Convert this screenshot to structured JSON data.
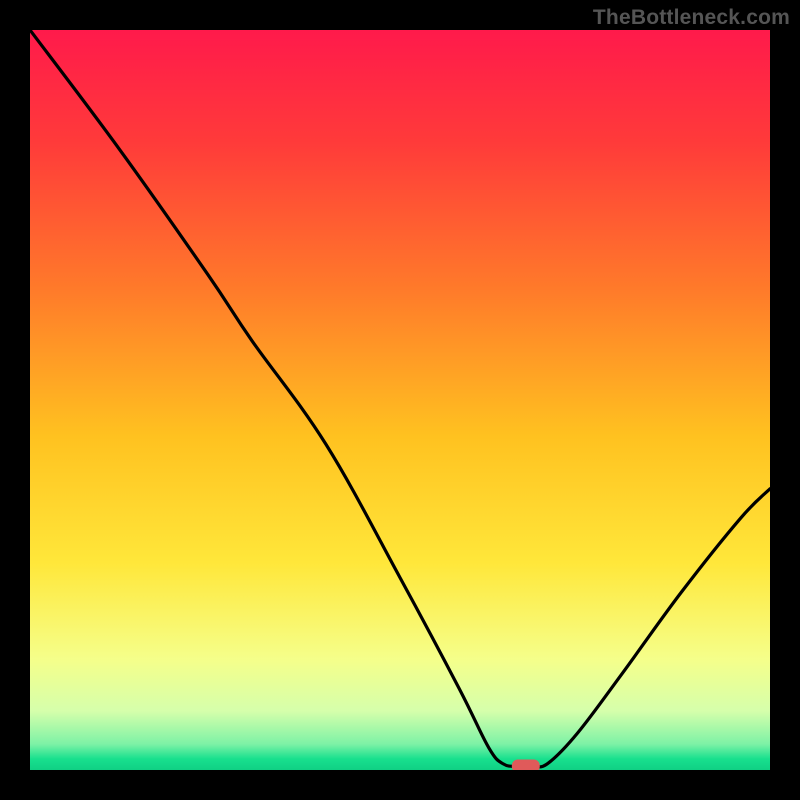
{
  "watermark": "TheBottleneck.com",
  "chart_data": {
    "type": "line",
    "title": "",
    "xlabel": "",
    "ylabel": "",
    "xlim": [
      0,
      100
    ],
    "ylim": [
      0,
      100
    ],
    "gradient_bands": [
      {
        "stop": 0.0,
        "color": "#ff1a4b"
      },
      {
        "stop": 0.15,
        "color": "#ff3a3a"
      },
      {
        "stop": 0.35,
        "color": "#ff7a2a"
      },
      {
        "stop": 0.55,
        "color": "#ffc220"
      },
      {
        "stop": 0.72,
        "color": "#ffe73a"
      },
      {
        "stop": 0.85,
        "color": "#f5ff8a"
      },
      {
        "stop": 0.92,
        "color": "#d6ffab"
      },
      {
        "stop": 0.965,
        "color": "#7df2a6"
      },
      {
        "stop": 0.985,
        "color": "#18e08e"
      },
      {
        "stop": 1.0,
        "color": "#10d084"
      }
    ],
    "series": [
      {
        "name": "curve",
        "points": [
          {
            "x": 0,
            "y": 100
          },
          {
            "x": 12,
            "y": 84
          },
          {
            "x": 24,
            "y": 67
          },
          {
            "x": 30,
            "y": 58
          },
          {
            "x": 40,
            "y": 44
          },
          {
            "x": 50,
            "y": 26
          },
          {
            "x": 58,
            "y": 11
          },
          {
            "x": 62,
            "y": 3
          },
          {
            "x": 64,
            "y": 0.8
          },
          {
            "x": 66,
            "y": 0.5
          },
          {
            "x": 68,
            "y": 0.5
          },
          {
            "x": 70,
            "y": 0.9
          },
          {
            "x": 74,
            "y": 5
          },
          {
            "x": 80,
            "y": 13
          },
          {
            "x": 88,
            "y": 24
          },
          {
            "x": 96,
            "y": 34
          },
          {
            "x": 100,
            "y": 38
          }
        ]
      }
    ],
    "marker": {
      "x": 67,
      "y": 0.6,
      "color": "#e05a5a"
    }
  }
}
